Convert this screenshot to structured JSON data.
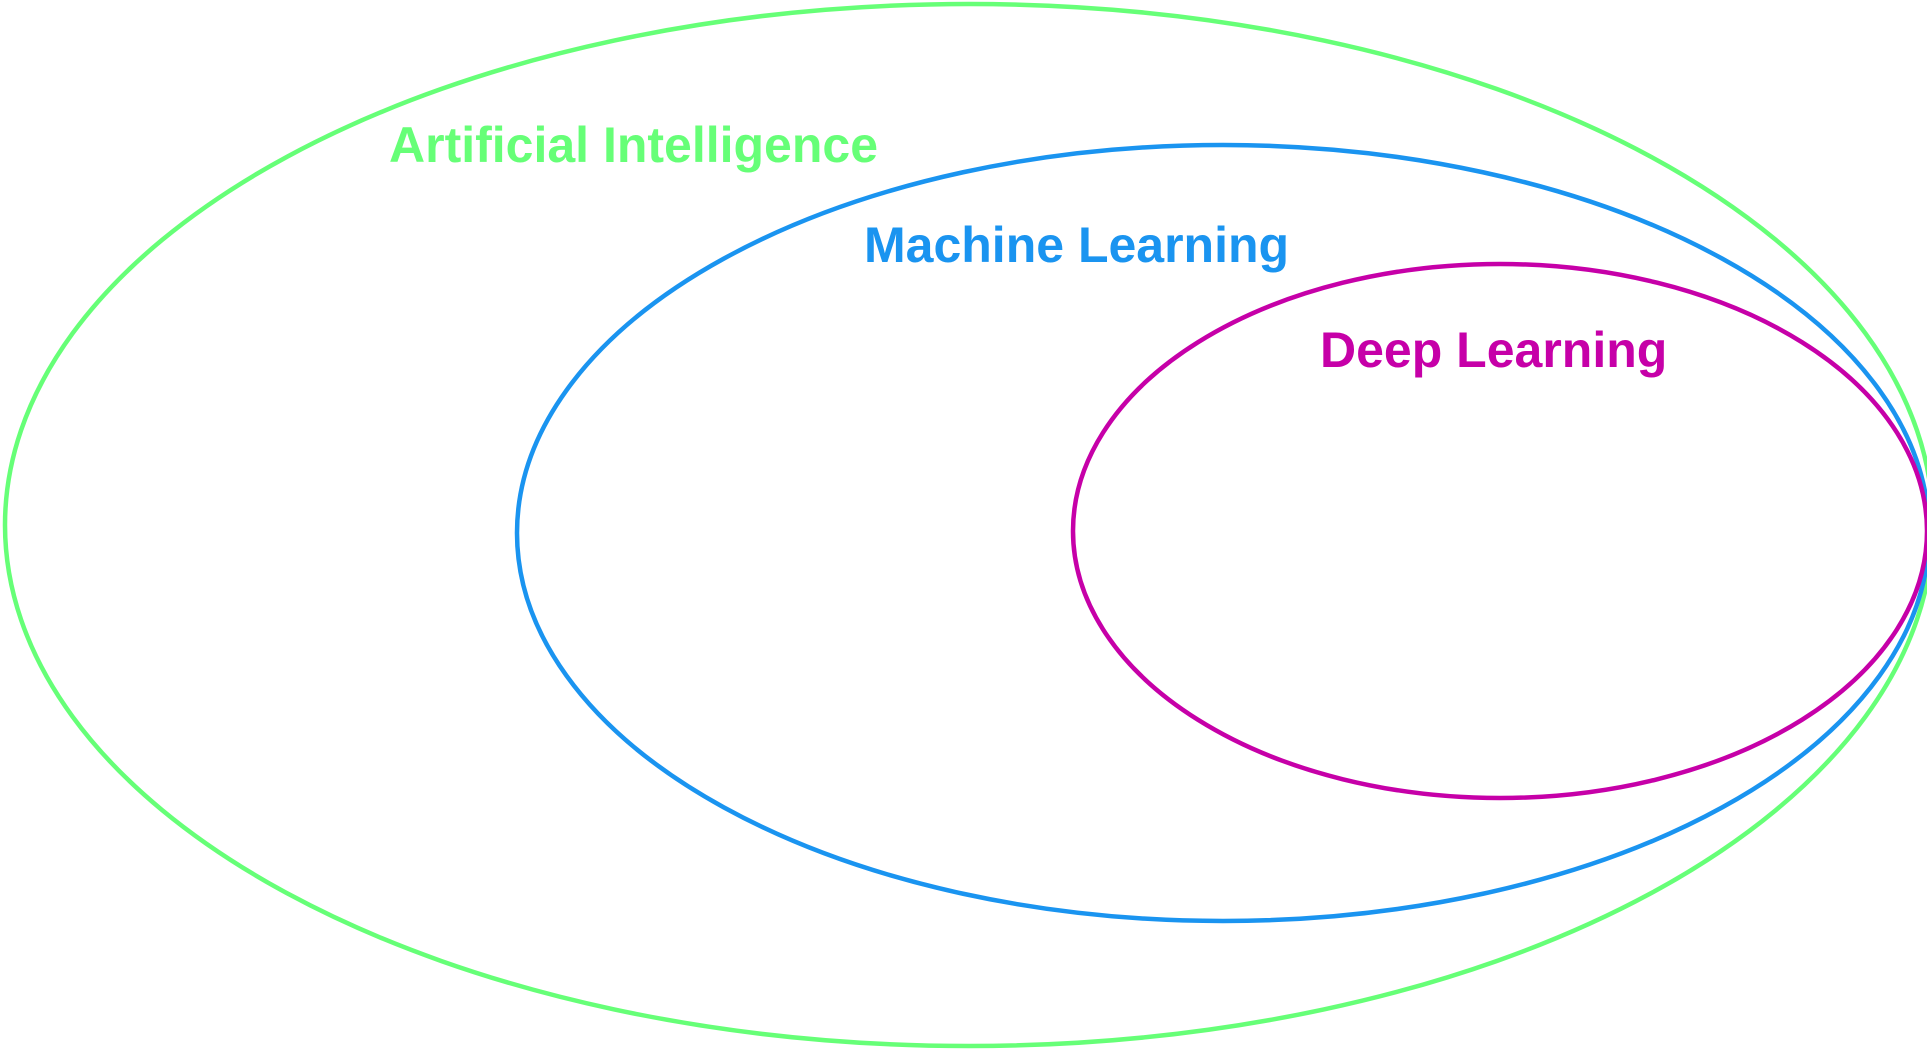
{
  "diagram": {
    "type": "nested-sets",
    "sets": [
      {
        "id": "ai",
        "label": "Artificial Intelligence",
        "color": "#66ff77"
      },
      {
        "id": "ml",
        "label": "Machine Learning",
        "color": "#1a94f0"
      },
      {
        "id": "dl",
        "label": "Deep Learning",
        "color": "#c600a8"
      }
    ],
    "nesting": [
      "ai",
      "ml",
      "dl"
    ]
  }
}
